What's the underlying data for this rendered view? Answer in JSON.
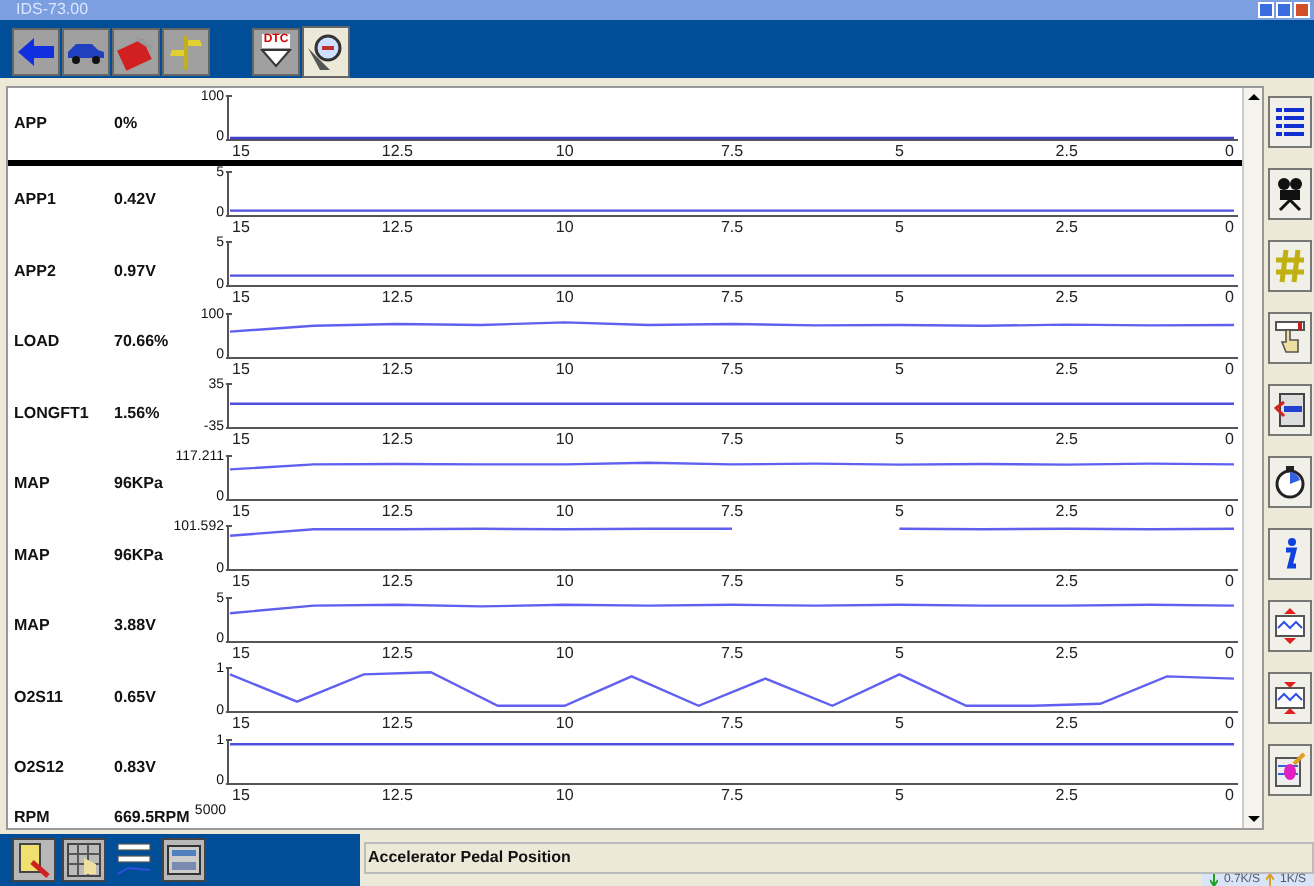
{
  "window": {
    "title": "IDS-73.00"
  },
  "tabs": [
    {
      "kind": "back",
      "selected": false
    },
    {
      "kind": "vehicle",
      "selected": false
    },
    {
      "kind": "toolbox",
      "selected": false
    },
    {
      "kind": "signpost",
      "selected": false
    },
    {
      "kind": "dtc",
      "label": "DTC",
      "selected": false
    },
    {
      "kind": "datalogger",
      "selected": true
    }
  ],
  "rows": [
    {
      "name": "APP",
      "value": "0%",
      "separator": true,
      "chart_data": {
        "type": "line",
        "x": [
          15,
          13.75,
          12.5,
          11.25,
          10,
          8.75,
          7.5,
          6.25,
          5,
          3.75,
          2.5,
          1.25,
          0
        ],
        "xlim": [
          15,
          0
        ],
        "xticks": [
          15,
          12.5,
          10,
          7.5,
          5,
          2.5,
          0
        ],
        "ylim": [
          0,
          100
        ],
        "yticks": [
          0,
          100
        ],
        "series": [
          {
            "color": "#4040d0",
            "values": [
              0,
              0,
              0,
              0,
              0,
              0,
              0,
              0,
              0,
              0,
              0,
              0,
              0
            ]
          }
        ]
      }
    },
    {
      "name": "APP1",
      "value": "0.42V",
      "separator": false,
      "chart_data": {
        "type": "line",
        "x": [
          15,
          13.75,
          12.5,
          11.25,
          10,
          8.75,
          7.5,
          6.25,
          5,
          3.75,
          2.5,
          1.25,
          0
        ],
        "xlim": [
          15,
          0
        ],
        "xticks": [
          15,
          12.5,
          10,
          7.5,
          5,
          2.5,
          0
        ],
        "ylim": [
          0,
          5
        ],
        "yticks": [
          0,
          5
        ],
        "series": [
          {
            "color": "#5050e0",
            "values": [
              0.4,
              0.4,
              0.4,
              0.4,
              0.4,
              0.4,
              0.4,
              0.4,
              0.4,
              0.4,
              0.4,
              0.4,
              0.4
            ]
          }
        ]
      }
    },
    {
      "name": "APP2",
      "value": "0.97V",
      "separator": false,
      "chart_data": {
        "type": "line",
        "x": [
          15,
          13.75,
          12.5,
          11.25,
          10,
          8.75,
          7.5,
          6.25,
          5,
          3.75,
          2.5,
          1.25,
          0
        ],
        "xlim": [
          15,
          0
        ],
        "xticks": [
          15,
          12.5,
          10,
          7.5,
          5,
          2.5,
          0
        ],
        "ylim": [
          0,
          5
        ],
        "yticks": [
          0,
          5
        ],
        "series": [
          {
            "color": "#5050e0",
            "values": [
              1,
              1,
              1,
              1,
              1,
              1,
              1,
              1,
              1,
              1,
              1,
              1,
              1
            ]
          }
        ]
      }
    },
    {
      "name": "LOAD",
      "value": "70.66%",
      "separator": false,
      "chart_data": {
        "type": "line",
        "x": [
          15,
          13.75,
          12.5,
          11.25,
          10,
          8.75,
          7.5,
          6.25,
          5,
          3.75,
          2.5,
          1.25,
          0
        ],
        "xlim": [
          15,
          0
        ],
        "xticks": [
          15,
          12.5,
          10,
          7.5,
          5,
          2.5,
          0
        ],
        "ylim": [
          0,
          100
        ],
        "yticks": [
          0,
          100
        ],
        "series": [
          {
            "color": "#6060f0",
            "values": [
              58,
              72,
              76,
              74,
              80,
              74,
              76,
              73,
              74,
              72,
              75,
              73,
              74
            ]
          }
        ]
      }
    },
    {
      "name": "LONGFT1",
      "value": "1.56%",
      "separator": false,
      "chart_data": {
        "type": "line",
        "x": [
          15,
          13.75,
          12.5,
          11.25,
          10,
          8.75,
          7.5,
          6.25,
          5,
          3.75,
          2.5,
          1.25,
          0
        ],
        "xlim": [
          15,
          0
        ],
        "xticks": [
          15,
          12.5,
          10,
          7.5,
          5,
          2.5,
          0
        ],
        "ylim": [
          -35,
          35
        ],
        "yticks": [
          -35,
          35
        ],
        "series": [
          {
            "color": "#5050e0",
            "values": [
              2,
              2,
              2,
              2,
              2,
              2,
              2,
              2,
              2,
              2,
              2,
              2,
              2
            ]
          }
        ]
      }
    },
    {
      "name": "MAP",
      "value": "96KPa",
      "separator": false,
      "chart_data": {
        "type": "line",
        "x": [
          15,
          13.75,
          12.5,
          11.25,
          10,
          8.75,
          7.5,
          6.25,
          5,
          3.75,
          2.5,
          1.25,
          0
        ],
        "xlim": [
          15,
          0
        ],
        "xticks": [
          15,
          12.5,
          10,
          7.5,
          5,
          2.5,
          0
        ],
        "ylim": [
          0,
          117.211
        ],
        "yticks": [
          0,
          117.211
        ],
        "series": [
          {
            "color": "#6060f0",
            "values": [
              80,
              94,
              95,
              94,
              94,
              98,
              94,
              96,
              93,
              95,
              93,
              96,
              94
            ]
          }
        ]
      }
    },
    {
      "name": "MAP",
      "value": "96KPa",
      "separator": false,
      "chart_data": {
        "type": "line",
        "x": [
          15,
          13.75,
          12.5,
          11.25,
          10,
          8.75,
          7.5,
          6.25,
          5,
          3.75,
          2.5,
          1.25,
          0
        ],
        "xlim": [
          15,
          0
        ],
        "xticks": [
          15,
          12.5,
          10,
          7.5,
          5,
          2.5,
          0
        ],
        "ylim": [
          0,
          101.592
        ],
        "yticks": [
          0,
          101.592
        ],
        "series": [
          {
            "color": "#6060f0",
            "values": [
              78,
              94,
              94,
              95,
              94,
              95,
              95,
              null,
              95,
              94,
              95,
              94,
              95
            ]
          }
        ]
      }
    },
    {
      "name": "MAP",
      "value": "3.88V",
      "separator": false,
      "chart_data": {
        "type": "line",
        "x": [
          15,
          13.75,
          12.5,
          11.25,
          10,
          8.75,
          7.5,
          6.25,
          5,
          3.75,
          2.5,
          1.25,
          0
        ],
        "xlim": [
          15,
          0
        ],
        "xticks": [
          15,
          12.5,
          10,
          7.5,
          5,
          2.5,
          0
        ],
        "ylim": [
          0,
          5
        ],
        "yticks": [
          0,
          5
        ],
        "series": [
          {
            "color": "#6060f0",
            "values": [
              3.2,
              4.1,
              4.2,
              4,
              4.2,
              4.1,
              4.2,
              4.1,
              4.2,
              4.1,
              4.1,
              4.2,
              4.1
            ]
          }
        ]
      }
    },
    {
      "name": "O2S11",
      "value": "0.65V",
      "separator": false,
      "chart_data": {
        "type": "line",
        "x": [
          15,
          14,
          13,
          12,
          11,
          10,
          9,
          8,
          7,
          6,
          5,
          4,
          3,
          2,
          1,
          0
        ],
        "xlim": [
          15,
          0
        ],
        "xticks": [
          15,
          12.5,
          10,
          7.5,
          5,
          2.5,
          0
        ],
        "ylim": [
          0,
          1
        ],
        "yticks": [
          0,
          1
        ],
        "series": [
          {
            "color": "#6060f0",
            "values": [
              0.85,
              0.2,
              0.85,
              0.9,
              0.1,
              0.1,
              0.8,
              0.1,
              0.75,
              0.1,
              0.85,
              0.1,
              0.1,
              0.15,
              0.8,
              0.75
            ]
          }
        ]
      }
    },
    {
      "name": "O2S12",
      "value": "0.83V",
      "separator": false,
      "chart_data": {
        "type": "line",
        "x": [
          15,
          13.75,
          12.5,
          11.25,
          10,
          8.75,
          7.5,
          6.25,
          5,
          3.75,
          2.5,
          1.25,
          0
        ],
        "xlim": [
          15,
          0
        ],
        "xticks": [
          15,
          12.5,
          10,
          7.5,
          5,
          2.5,
          0
        ],
        "ylim": [
          0,
          1
        ],
        "yticks": [
          0,
          1
        ],
        "series": [
          {
            "color": "#5050e0",
            "values": [
              0.9,
              0.9,
              0.9,
              0.9,
              0.9,
              0.9,
              0.9,
              0.9,
              0.9,
              0.9,
              0.9,
              0.9,
              0.9
            ]
          }
        ]
      }
    }
  ],
  "partial_row": {
    "name": "RPM",
    "value": "669.5RPM",
    "y_max": "5000"
  },
  "side_tools": [
    {
      "kind": "list"
    },
    {
      "kind": "camera"
    },
    {
      "kind": "hash"
    },
    {
      "kind": "hand"
    },
    {
      "kind": "stack"
    },
    {
      "kind": "stopwatch"
    },
    {
      "kind": "info"
    },
    {
      "kind": "expand"
    },
    {
      "kind": "shrink"
    },
    {
      "kind": "paint"
    }
  ],
  "bottom_tools": [
    {
      "kind": "notebook",
      "selected": true
    },
    {
      "kind": "grid",
      "selected": true
    },
    {
      "kind": "graphs",
      "selected": false
    },
    {
      "kind": "panel",
      "selected": true
    }
  ],
  "status_text": "Accelerator Pedal Position",
  "tray": {
    "down": "0.7K/S",
    "up": "1K/S"
  }
}
